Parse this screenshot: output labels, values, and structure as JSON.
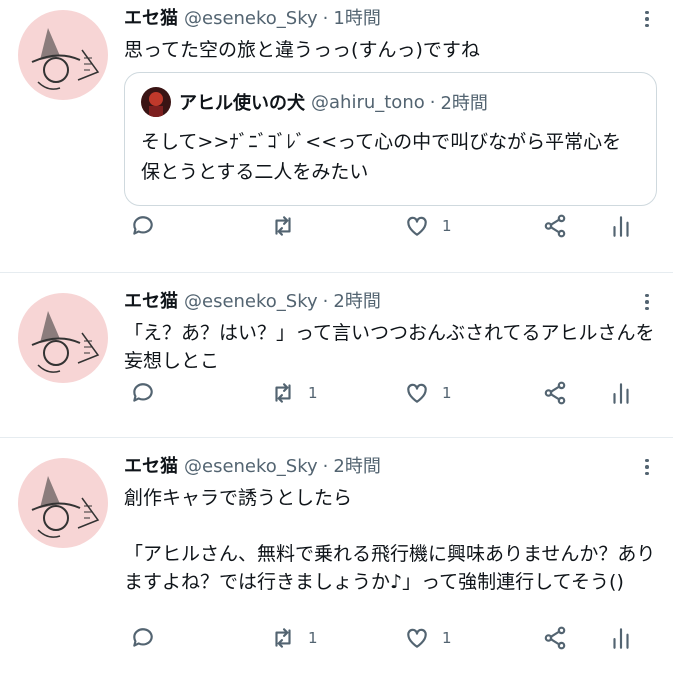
{
  "tweets": [
    {
      "name": "エセ猫",
      "handle": "@eseneko_Sky",
      "time": "1時間",
      "text": "思ってた空の旅と違うっっ(すんっ)ですね",
      "quote": {
        "name": "アヒル使いの犬",
        "handle": "@ahiru_tono",
        "time": "2時間",
        "text": "そして>>ﾅﾞﾆﾞｺﾞﾚﾞ<<って心の中で叫びながら平常心を保とうとする二人をみたい"
      },
      "counts": {
        "reply": "",
        "retweet": "",
        "like": "1"
      }
    },
    {
      "name": "エセ猫",
      "handle": "@eseneko_Sky",
      "time": "2時間",
      "text": "「え？あ？はい？」って言いつつおんぶされてるアヒルさんを妄想しとこ",
      "counts": {
        "reply": "",
        "retweet": "1",
        "like": "1"
      }
    },
    {
      "name": "エセ猫",
      "handle": "@eseneko_Sky",
      "time": "2時間",
      "text": "創作キャラで誘うとしたら\n\n「アヒルさん、無料で乗れる飛行機に興味ありませんか？ありますよね？では行きましょうか♪」って強制連行してそう()",
      "counts": {
        "reply": "",
        "retweet": "1",
        "like": "1"
      }
    }
  ],
  "separator": "·",
  "icons": [
    "reply-icon",
    "retweet-icon",
    "like-icon",
    "share-icon",
    "analytics-icon",
    "more-icon"
  ],
  "colors": {
    "text": "#0f1419",
    "secondary": "#536471",
    "border": "#e6ecf0",
    "avatar_bg": "#f7d5d5"
  }
}
